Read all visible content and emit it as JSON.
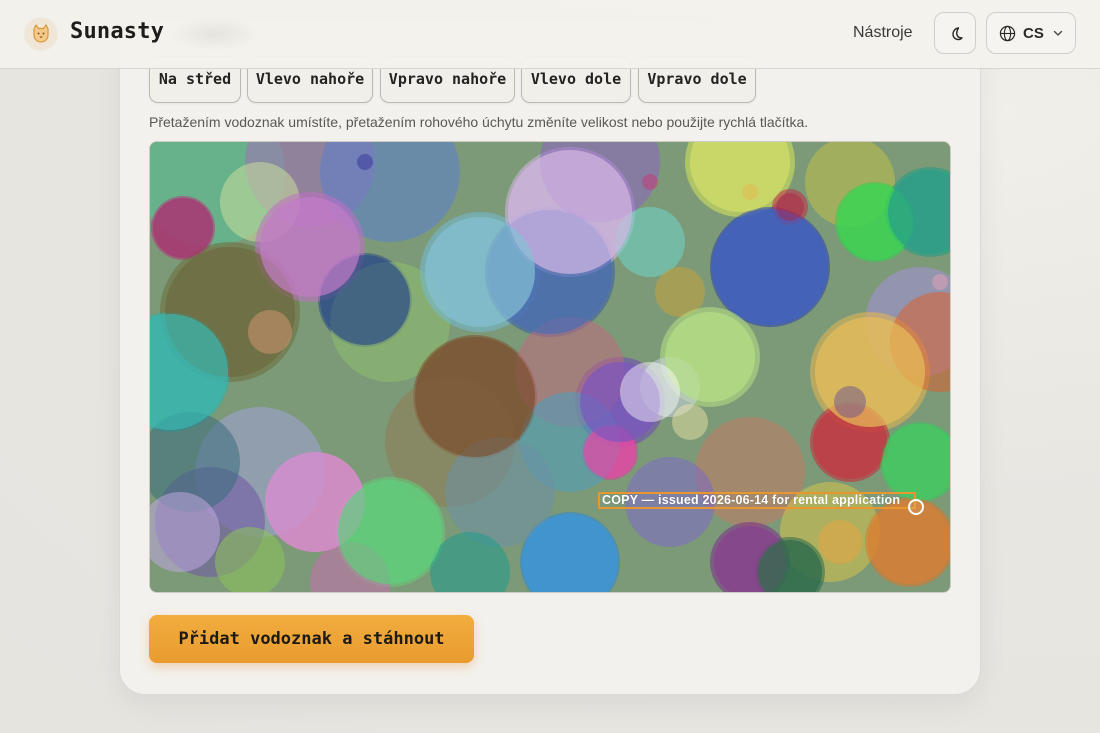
{
  "header": {
    "brand": "Sunasty",
    "nav_tools": "Nástroje",
    "language": "CS"
  },
  "positions": {
    "center": "Na střed",
    "top_left": "Vlevo nahoře",
    "top_right": "Vpravo nahoře",
    "bottom_left": "Vlevo dole",
    "bottom_right": "Vpravo dole"
  },
  "hint": "Přetažením vodoznak umístíte, přetažením rohového úchytu změníte velikost nebo použijte rychlá tlačítka.",
  "watermark": {
    "text": "COPY — issued 2026-06-14 for rental application",
    "box_color": "#e8962f"
  },
  "action_button": "Přidat vodoznak a stáhnout",
  "colors": {
    "accent": "#eea236",
    "text": "#1e1d1b"
  },
  "icons": {
    "logo": "cat-logo-icon",
    "theme": "moon-icon",
    "language": "globe-icon",
    "dropdown": "chevron-down-icon",
    "resize": "resize-handle-icon"
  }
}
